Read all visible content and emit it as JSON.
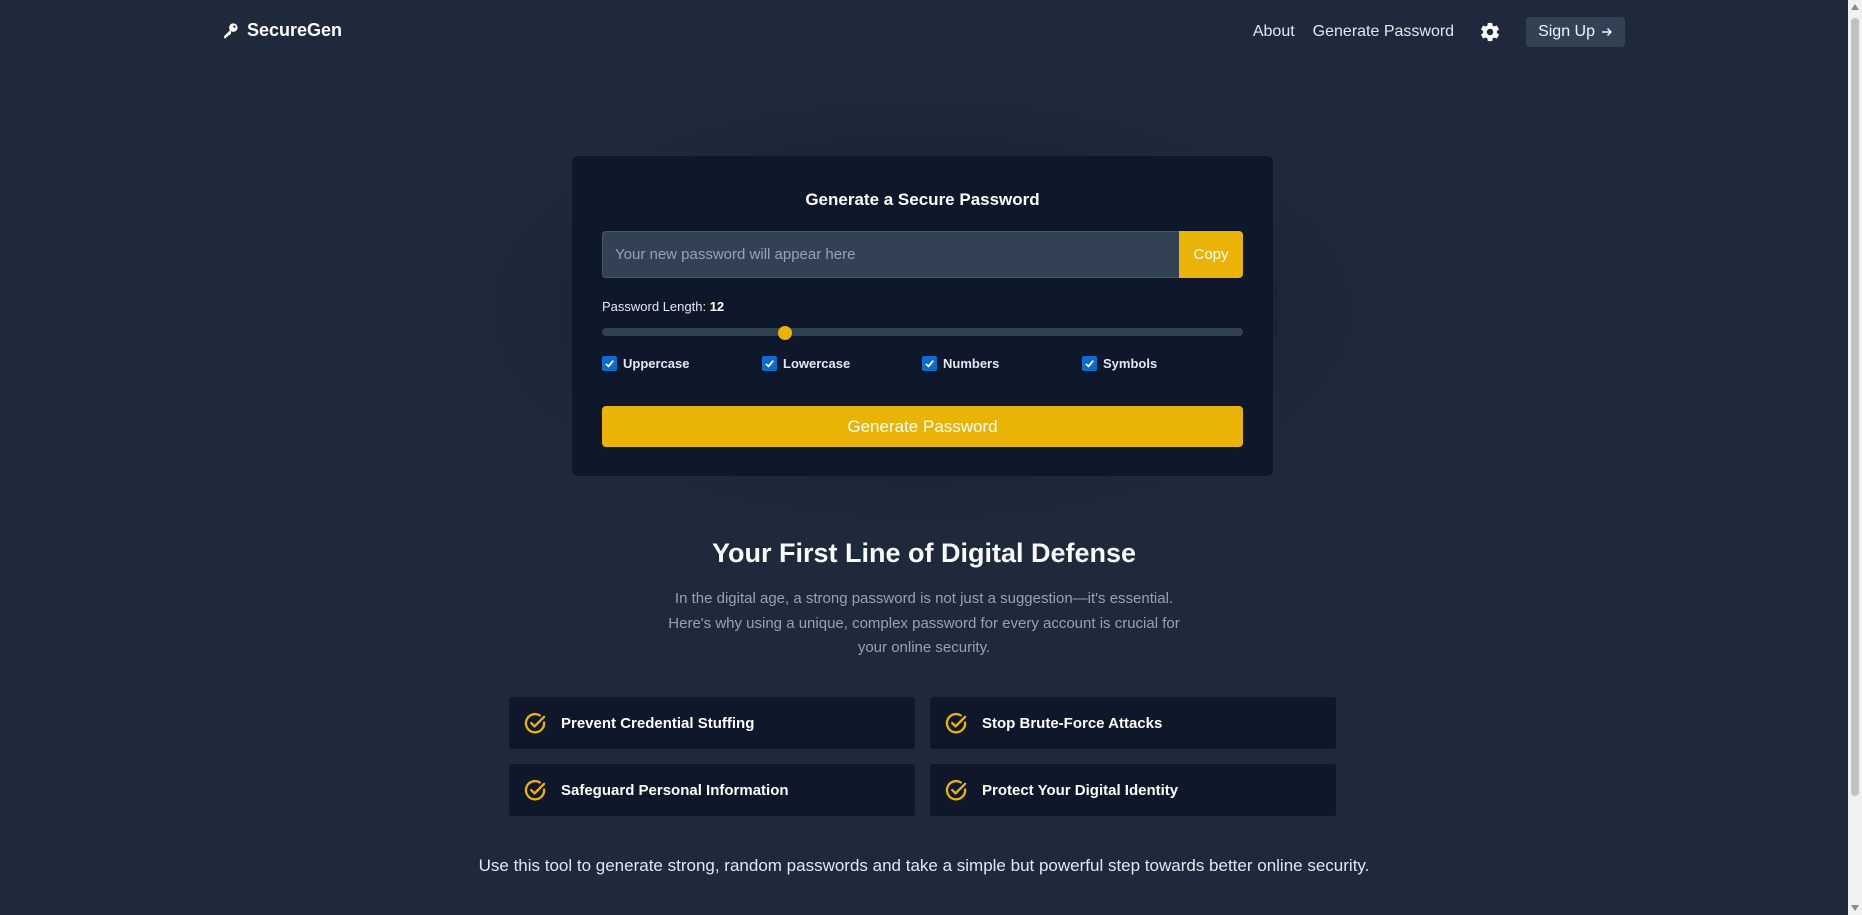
{
  "header": {
    "brand": "SecureGen",
    "nav": [
      "About",
      "Generate Password"
    ],
    "signup_label": "Sign Up"
  },
  "generator": {
    "title": "Generate a Secure Password",
    "placeholder": "Your new password will appear here",
    "copy_label": "Copy",
    "length_label": "Password Length:",
    "length_value": "12",
    "length_min": 4,
    "length_max": 32,
    "options": [
      {
        "label": "Uppercase",
        "checked": true
      },
      {
        "label": "Lowercase",
        "checked": true
      },
      {
        "label": "Numbers",
        "checked": true
      },
      {
        "label": "Symbols",
        "checked": true
      }
    ],
    "generate_label": "Generate Password"
  },
  "info": {
    "title": "Your First Line of Digital Defense",
    "description": "In the digital age, a strong password is not just a suggestion—it's essential. Here's why using a unique, complex password for every account is crucial for your online security.",
    "features": [
      "Prevent Credential Stuffing",
      "Stop Brute-Force Attacks",
      "Safeguard Personal Information",
      "Protect Your Digital Identity"
    ],
    "footer": "Use this tool to generate strong, random passwords and take a simple but powerful step towards better online security."
  },
  "colors": {
    "background": "#1e293b",
    "card": "#0f172a",
    "accent": "#eab308",
    "checkbox": "#0b6bd3"
  },
  "icons": {
    "brand": "key-icon",
    "settings": "gear-icon",
    "signup": "arrow-right-icon",
    "feature": "check-circle-icon"
  }
}
